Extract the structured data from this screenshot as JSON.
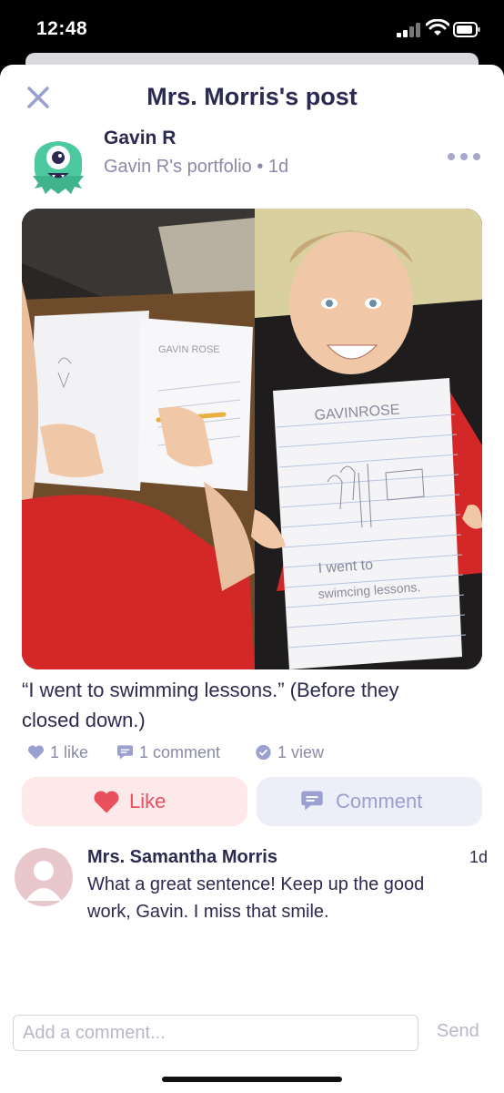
{
  "status_bar": {
    "time": "12:48",
    "signal_icon": "cellular-signal-icon",
    "wifi_icon": "wifi-icon",
    "battery_icon": "battery-icon"
  },
  "header": {
    "title": "Mrs. Morris's post",
    "close_icon": "close-icon"
  },
  "post": {
    "author": "Gavin R",
    "portfolio_line": "Gavin R's portfolio • 1d",
    "more_icon": "more-options-icon",
    "photo_left_paper_text": "GAVIN ROSE",
    "photo_right_paper_name": "GAVINROSE",
    "photo_right_paper_line1": "I went to",
    "photo_right_paper_line2": "swimcing lessons.",
    "caption": "“I went to swimming lessons.” (Before they closed down.)",
    "stats": {
      "likes": "1 like",
      "comments": "1 comment",
      "views": "1 view"
    },
    "like_button": "Like",
    "comment_button": "Comment"
  },
  "comment": {
    "name": "Mrs. Samantha Morris",
    "time": "1d",
    "text": "What a great sentence!  Keep up the good work, Gavin.  I miss that smile."
  },
  "composer": {
    "placeholder": "Add a comment...",
    "send": "Send"
  },
  "colors": {
    "accent_red": "#e8505b",
    "accent_blue": "#9aa0d0",
    "text_dark": "#2c2a50",
    "text_muted": "#8a8aa8"
  }
}
